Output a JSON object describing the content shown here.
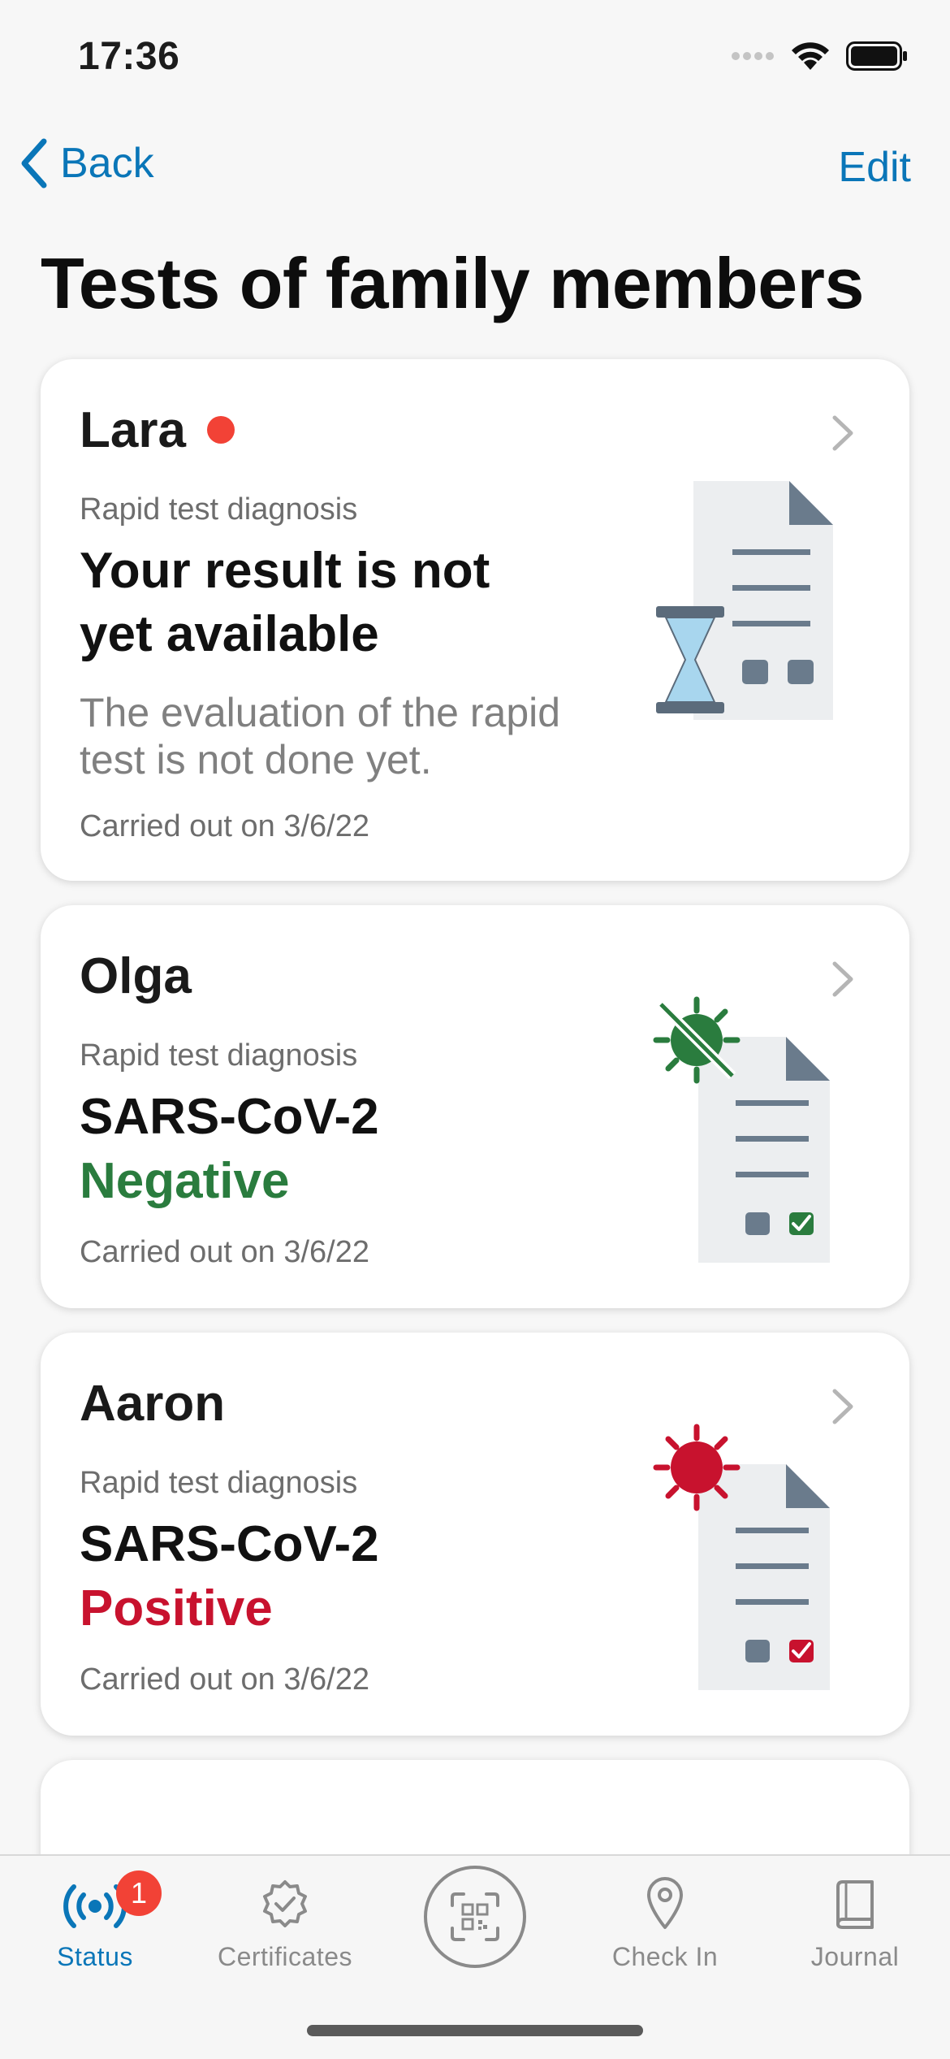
{
  "status_bar": {
    "time": "17:36"
  },
  "nav": {
    "back_label": "Back",
    "edit_label": "Edit"
  },
  "title": "Tests of family members",
  "cards": [
    {
      "name": "Lara",
      "subtitle": "Rapid test diagnosis",
      "headline_line1": "Your result is not",
      "headline_line2": "yet available",
      "description": "The evaluation of the rapid test is not done yet.",
      "date": "Carried out on 3/6/22",
      "unread": true,
      "icon": "document-hourglass-icon"
    },
    {
      "name": "Olga",
      "subtitle": "Rapid test diagnosis",
      "headline": "SARS-CoV-2",
      "result": "Negative",
      "date": "Carried out on 3/6/22",
      "icon": "document-virus-negative-icon",
      "result_color": "#2a7c3e"
    },
    {
      "name": "Aaron",
      "subtitle": "Rapid test diagnosis",
      "headline": "SARS-CoV-2",
      "result": "Positive",
      "date": "Carried out on 3/6/22",
      "icon": "document-virus-positive-icon",
      "result_color": "#c8122e"
    }
  ],
  "tab_bar": {
    "tabs": [
      {
        "label": "Status",
        "icon": "broadcast-icon",
        "active": true,
        "badge": "1"
      },
      {
        "label": "Certificates",
        "icon": "certificate-badge-icon",
        "active": false
      },
      {
        "label": "",
        "icon": "qr-scan-icon",
        "active": false
      },
      {
        "label": "Check In",
        "icon": "location-pin-icon",
        "active": false
      },
      {
        "label": "Journal",
        "icon": "book-icon",
        "active": false
      }
    ]
  },
  "colors": {
    "accent": "#0a76b8",
    "negative": "#2a7c3e",
    "positive": "#c8122e",
    "badge": "#f24236"
  }
}
